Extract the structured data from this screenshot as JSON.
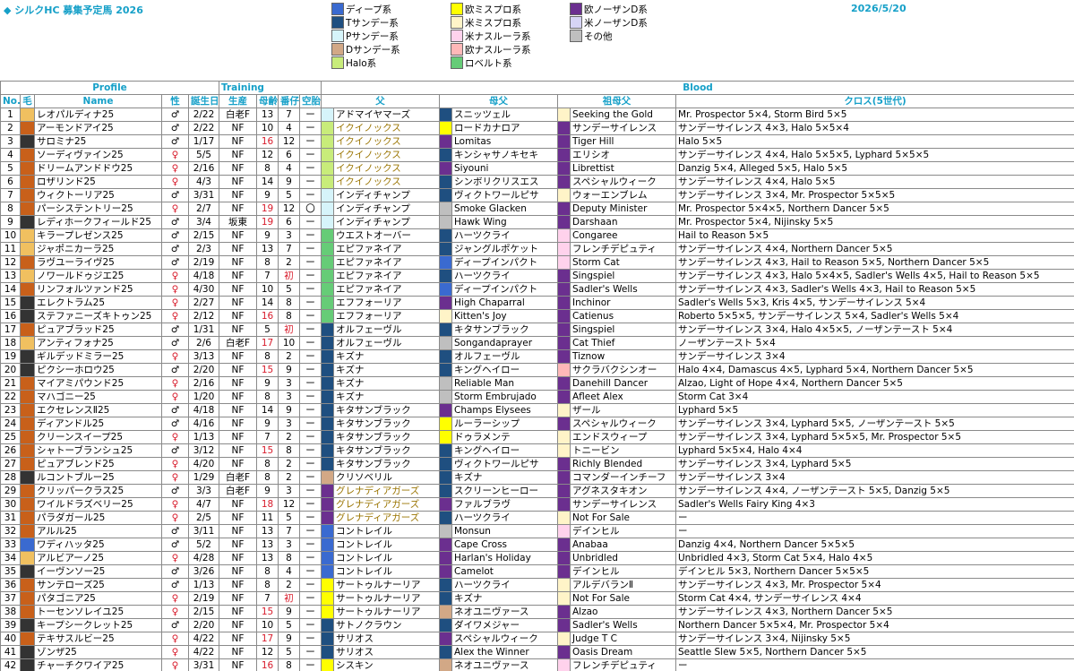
{
  "header": {
    "title": "◆ シルクHC 募集予定馬 2026",
    "date": "2026/5/20"
  },
  "legend": [
    {
      "label": "ディープ系",
      "color": "#3a6ad0"
    },
    {
      "label": "Tサンデー系",
      "color": "#1f4f80"
    },
    {
      "label": "Pサンデー系",
      "color": "#d6f4fa"
    },
    {
      "label": "Dサンデー系",
      "color": "#d2a886"
    },
    {
      "label": "Halo系",
      "color": "#c8ec7a"
    },
    {
      "label": "欧ミスプロ系",
      "color": "#ffff00"
    },
    {
      "label": "米ミスプロ系",
      "color": "#fff4c8"
    },
    {
      "label": "米ナスルーラ系",
      "color": "#ffd2ec"
    },
    {
      "label": "欧ナスルーラ系",
      "color": "#ffb8b8"
    },
    {
      "label": "ロベルト系",
      "color": "#66cc77"
    },
    {
      "label": "欧ノーザンD系",
      "color": "#6b2f8f"
    },
    {
      "label": "米ノーザンD系",
      "color": "#d6d4f5"
    },
    {
      "label": "その他",
      "color": "#bfbfbf"
    }
  ],
  "columns": {
    "group_profile": "Profile",
    "group_training": "Training",
    "group_blood": "Blood",
    "no": "No.",
    "coat": "毛",
    "name": "Name",
    "sex": "性",
    "birthday": "誕生日",
    "farm": "生産",
    "dam_age": "母齢",
    "birth_order": "番仔",
    "empty": "空胎",
    "sire": "父",
    "dam_sire": "母父",
    "dam_dam_sire": "祖母父",
    "cross": "クロス(5世代)"
  },
  "rows": [
    {
      "no": "1",
      "coat": "#f0c060",
      "name": "レオパルディナ25",
      "sex": "♂",
      "bd": "2/22",
      "farm": "白老F",
      "age": "13",
      "ord": "7",
      "emp": "ー",
      "ac": false,
      "sc": "#d6f4fa",
      "sire": "アドマイヤマーズ",
      "sg": false,
      "dc": "#1f4f80",
      "ds": "スニッツェル",
      "ddc": "#fff4c8",
      "dds": "Seeking the Gold",
      "cross": "Mr. Prospector 5×4, Storm Bird 5×5"
    },
    {
      "no": "2",
      "coat": "#c8601a",
      "name": "アーモンドアイ25",
      "sex": "♂",
      "bd": "2/22",
      "farm": "NF",
      "age": "10",
      "ord": "4",
      "emp": "ー",
      "ac": false,
      "sc": "#c8ec7a",
      "sire": "イクイノックス",
      "sg": true,
      "dc": "#ffff00",
      "ds": "ロードカナロア",
      "ddc": "#6b2f8f",
      "dds": "サンデーサイレンス",
      "cross": "サンデーサイレンス 4×3, Halo 5×5×4"
    },
    {
      "no": "3",
      "coat": "#333333",
      "name": "サロミナ25",
      "sex": "♂",
      "bd": "1/17",
      "farm": "NF",
      "age": "16",
      "ord": "12",
      "emp": "ー",
      "ac": true,
      "sc": "#c8ec7a",
      "sire": "イクイノックス",
      "sg": true,
      "dc": "#6b2f8f",
      "ds": "Lomitas",
      "ddc": "#6b2f8f",
      "dds": "Tiger Hill",
      "cross": "Halo 5×5"
    },
    {
      "no": "4",
      "coat": "#c8601a",
      "name": "ソーディヴァイン25",
      "sex": "♀",
      "bd": "5/5",
      "farm": "NF",
      "age": "12",
      "ord": "6",
      "emp": "ー",
      "ac": false,
      "sc": "#c8ec7a",
      "sire": "イクイノックス",
      "sg": true,
      "dc": "#1f4f80",
      "ds": "キンシャサノキセキ",
      "ddc": "#6b2f8f",
      "dds": "エリシオ",
      "cross": "サンデーサイレンス 4×4, Halo 5×5×5, Lyphard 5×5×5"
    },
    {
      "no": "5",
      "coat": "#c8601a",
      "name": "ドリームアンドドウ25",
      "sex": "♀",
      "bd": "2/16",
      "farm": "NF",
      "age": "8",
      "ord": "4",
      "emp": "ー",
      "ac": false,
      "sc": "#c8ec7a",
      "sire": "イクイノックス",
      "sg": true,
      "dc": "#6b2f8f",
      "ds": "Siyouni",
      "ddc": "#6b2f8f",
      "dds": "Librettist",
      "cross": "Danzig 5×4, Alleged 5×5, Halo 5×5"
    },
    {
      "no": "6",
      "coat": "#c8601a",
      "name": "ロザリンド25",
      "sex": "♀",
      "bd": "4/3",
      "farm": "NF",
      "age": "14",
      "ord": "9",
      "emp": "ー",
      "ac": false,
      "sc": "#c8ec7a",
      "sire": "イクイノックス",
      "sg": true,
      "dc": "#1f4f80",
      "ds": "シンボリクリスエス",
      "ddc": "#6b2f8f",
      "dds": "スペシャルウィーク",
      "cross": "サンデーサイレンス 4×4, Halo 5×5"
    },
    {
      "no": "7",
      "coat": "#c8601a",
      "name": "ウィクトーリア25",
      "sex": "♂",
      "bd": "3/31",
      "farm": "NF",
      "age": "9",
      "ord": "5",
      "emp": "ー",
      "ac": false,
      "sc": "#d6f4fa",
      "sire": "インディチャンプ",
      "sg": false,
      "dc": "#1f4f80",
      "ds": "ヴィクトワールピサ",
      "ddc": "#fff4c8",
      "dds": "ウォーエンブレム",
      "cross": "サンデーサイレンス 3×4, Mr. Prospector 5×5×5"
    },
    {
      "no": "8",
      "coat": "#c8601a",
      "name": "パーシステントリー25",
      "sex": "♀",
      "bd": "2/7",
      "farm": "NF",
      "age": "19",
      "ord": "12",
      "emp": "〇",
      "ac": true,
      "sc": "#d6f4fa",
      "sire": "インディチャンプ",
      "sg": false,
      "dc": "#bfbfbf",
      "ds": "Smoke Glacken",
      "ddc": "#6b2f8f",
      "dds": "Deputy Minister",
      "cross": "Mr. Prospector 5×4×5, Northern Dancer 5×5"
    },
    {
      "no": "9",
      "coat": "#333333",
      "name": "レディホークフィールド25",
      "sex": "♂",
      "bd": "3/4",
      "farm": "坂東",
      "age": "19",
      "ord": "6",
      "emp": "ー",
      "ac": true,
      "sc": "#d6f4fa",
      "sire": "インディチャンプ",
      "sg": false,
      "dc": "#bfbfbf",
      "ds": "Hawk Wing",
      "ddc": "#6b2f8f",
      "dds": "Darshaan",
      "cross": "Mr. Prospector 5×4, Nijinsky 5×5"
    },
    {
      "no": "10",
      "coat": "#f0c060",
      "name": "キラープレゼンス25",
      "sex": "♂",
      "bd": "2/15",
      "farm": "NF",
      "age": "9",
      "ord": "3",
      "emp": "ー",
      "ac": false,
      "sc": "#66cc77",
      "sire": "ウエストオーバー",
      "sg": false,
      "dc": "#1f4f80",
      "ds": "ハーツクライ",
      "ddc": "#ffd2ec",
      "dds": "Congaree",
      "cross": "Hail to Reason 5×5"
    },
    {
      "no": "11",
      "coat": "#f0c060",
      "name": "ジャポニカーラ25",
      "sex": "♂",
      "bd": "2/3",
      "farm": "NF",
      "age": "13",
      "ord": "7",
      "emp": "ー",
      "ac": false,
      "sc": "#66cc77",
      "sire": "エピファネイア",
      "sg": false,
      "dc": "#1f4f80",
      "ds": "ジャングルポケット",
      "ddc": "#ffd2ec",
      "dds": "フレンチデピュティ",
      "cross": "サンデーサイレンス 4×4, Northern Dancer 5×5"
    },
    {
      "no": "12",
      "coat": "#c8601a",
      "name": "ラヴユーライヴ25",
      "sex": "♂",
      "bd": "2/19",
      "farm": "NF",
      "age": "8",
      "ord": "2",
      "emp": "ー",
      "ac": false,
      "sc": "#66cc77",
      "sire": "エピファネイア",
      "sg": false,
      "dc": "#3a6ad0",
      "ds": "ディープインパクト",
      "ddc": "#ffd2ec",
      "dds": "Storm Cat",
      "cross": "サンデーサイレンス 4×3, Hail to Reason 5×5, Northern Dancer 5×5"
    },
    {
      "no": "13",
      "coat": "#f0c060",
      "name": "ノワールドゥジエ25",
      "sex": "♀",
      "bd": "4/18",
      "farm": "NF",
      "age": "7",
      "ord": "初",
      "emp": "ー",
      "ac": false,
      "sc": "#66cc77",
      "sire": "エピファネイア",
      "sg": false,
      "dc": "#1f4f80",
      "ds": "ハーツクライ",
      "ddc": "#6b2f8f",
      "dds": "Singspiel",
      "cross": "サンデーサイレンス 4×3, Halo 5×4×5, Sadler's Wells 4×5, Hail to Reason 5×5"
    },
    {
      "no": "14",
      "coat": "#c8601a",
      "name": "リンフォルツァンド25",
      "sex": "♀",
      "bd": "4/30",
      "farm": "NF",
      "age": "10",
      "ord": "5",
      "emp": "ー",
      "ac": false,
      "sc": "#66cc77",
      "sire": "エピファネイア",
      "sg": false,
      "dc": "#3a6ad0",
      "ds": "ディープインパクト",
      "ddc": "#6b2f8f",
      "dds": "Sadler's Wells",
      "cross": "サンデーサイレンス 4×3, Sadler's Wells 4×3, Hail to Reason 5×5"
    },
    {
      "no": "15",
      "coat": "#333333",
      "name": "エレクトラム25",
      "sex": "♀",
      "bd": "2/27",
      "farm": "NF",
      "age": "14",
      "ord": "8",
      "emp": "ー",
      "ac": false,
      "sc": "#66cc77",
      "sire": "エフフォーリア",
      "sg": false,
      "dc": "#6b2f8f",
      "ds": "High Chaparral",
      "ddc": "#6b2f8f",
      "dds": "Inchinor",
      "cross": "Sadler's Wells 5×3, Kris 4×5, サンデーサイレンス 5×4"
    },
    {
      "no": "16",
      "coat": "#333333",
      "name": "ステファニーズキトゥン25",
      "sex": "♀",
      "bd": "2/12",
      "farm": "NF",
      "age": "16",
      "ord": "8",
      "emp": "ー",
      "ac": true,
      "sc": "#66cc77",
      "sire": "エフフォーリア",
      "sg": false,
      "dc": "#fff4c8",
      "ds": "Kitten's Joy",
      "ddc": "#6b2f8f",
      "dds": "Catienus",
      "cross": "Roberto 5×5×5, サンデーサイレンス 5×4, Sadler's Wells 5×4"
    },
    {
      "no": "17",
      "coat": "#c8601a",
      "name": "ピュアブラッド25",
      "sex": "♂",
      "bd": "1/31",
      "farm": "NF",
      "age": "5",
      "ord": "初",
      "emp": "ー",
      "ac": false,
      "sc": "#1f4f80",
      "sire": "オルフェーヴル",
      "sg": false,
      "dc": "#1f4f80",
      "ds": "キタサンブラック",
      "ddc": "#6b2f8f",
      "dds": "Singspiel",
      "cross": "サンデーサイレンス 3×4, Halo 4×5×5, ノーザンテースト 5×4"
    },
    {
      "no": "18",
      "coat": "#f0c060",
      "name": "アンティフォナ25",
      "sex": "♂",
      "bd": "2/6",
      "farm": "白老F",
      "age": "17",
      "ord": "10",
      "emp": "ー",
      "ac": true,
      "sc": "#1f4f80",
      "sire": "オルフェーヴル",
      "sg": false,
      "dc": "#bfbfbf",
      "ds": "Songandaprayer",
      "ddc": "#6b2f8f",
      "dds": "Cat Thief",
      "cross": "ノーザンテースト 5×4"
    },
    {
      "no": "19",
      "coat": "#333333",
      "name": "ギルデッドミラー25",
      "sex": "♀",
      "bd": "3/13",
      "farm": "NF",
      "age": "8",
      "ord": "2",
      "emp": "ー",
      "ac": false,
      "sc": "#1f4f80",
      "sire": "キズナ",
      "sg": false,
      "dc": "#1f4f80",
      "ds": "オルフェーヴル",
      "ddc": "#6b2f8f",
      "dds": "Tiznow",
      "cross": "サンデーサイレンス 3×4"
    },
    {
      "no": "20",
      "coat": "#333333",
      "name": "ピクシーホロウ25",
      "sex": "♂",
      "bd": "2/20",
      "farm": "NF",
      "age": "15",
      "ord": "9",
      "emp": "ー",
      "ac": true,
      "sc": "#1f4f80",
      "sire": "キズナ",
      "sg": false,
      "dc": "#1f4f80",
      "ds": "キングヘイロー",
      "ddc": "#ffb8b8",
      "dds": "サクラバクシンオー",
      "cross": "Halo 4×4, Damascus 4×5, Lyphard 5×4, Northern Dancer 5×5"
    },
    {
      "no": "21",
      "coat": "#c8601a",
      "name": "マイアミパウンド25",
      "sex": "♀",
      "bd": "2/16",
      "farm": "NF",
      "age": "9",
      "ord": "3",
      "emp": "ー",
      "ac": false,
      "sc": "#1f4f80",
      "sire": "キズナ",
      "sg": false,
      "dc": "#bfbfbf",
      "ds": "Reliable Man",
      "ddc": "#6b2f8f",
      "dds": "Danehill Dancer",
      "cross": "Alzao, Light of Hope 4×4, Northern Dancer 5×5"
    },
    {
      "no": "22",
      "coat": "#c8601a",
      "name": "マハゴニー25",
      "sex": "♀",
      "bd": "1/20",
      "farm": "NF",
      "age": "8",
      "ord": "3",
      "emp": "ー",
      "ac": false,
      "sc": "#1f4f80",
      "sire": "キズナ",
      "sg": false,
      "dc": "#bfbfbf",
      "ds": "Storm Embrujado",
      "ddc": "#6b2f8f",
      "dds": "Afleet Alex",
      "cross": "Storm Cat 3×4"
    },
    {
      "no": "23",
      "coat": "#c8601a",
      "name": "エクセレンスⅡ25",
      "sex": "♂",
      "bd": "4/18",
      "farm": "NF",
      "age": "14",
      "ord": "9",
      "emp": "ー",
      "ac": false,
      "sc": "#1f4f80",
      "sire": "キタサンブラック",
      "sg": false,
      "dc": "#6b2f8f",
      "ds": "Champs Elysees",
      "ddc": "#fff4c8",
      "dds": "ザール",
      "cross": "Lyphard 5×5"
    },
    {
      "no": "24",
      "coat": "#c8601a",
      "name": "ディアンドル25",
      "sex": "♂",
      "bd": "4/16",
      "farm": "NF",
      "age": "9",
      "ord": "3",
      "emp": "ー",
      "ac": false,
      "sc": "#1f4f80",
      "sire": "キタサンブラック",
      "sg": false,
      "dc": "#ffff00",
      "ds": "ルーラーシップ",
      "ddc": "#6b2f8f",
      "dds": "スペシャルウィーク",
      "cross": "サンデーサイレンス 3×4, Lyphard 5×5, ノーザンテースト 5×5"
    },
    {
      "no": "25",
      "coat": "#c8601a",
      "name": "クリーンスイープ25",
      "sex": "♀",
      "bd": "1/13",
      "farm": "NF",
      "age": "7",
      "ord": "2",
      "emp": "ー",
      "ac": false,
      "sc": "#1f4f80",
      "sire": "キタサンブラック",
      "sg": false,
      "dc": "#ffff00",
      "ds": "ドゥラメンテ",
      "ddc": "#fff4c8",
      "dds": "エンドスウィープ",
      "cross": "サンデーサイレンス 3×4, Lyphard 5×5×5, Mr. Prospector 5×5"
    },
    {
      "no": "26",
      "coat": "#c8601a",
      "name": "シャトーブランシュ25",
      "sex": "♂",
      "bd": "3/12",
      "farm": "NF",
      "age": "15",
      "ord": "8",
      "emp": "ー",
      "ac": true,
      "sc": "#1f4f80",
      "sire": "キタサンブラック",
      "sg": false,
      "dc": "#1f4f80",
      "ds": "キングヘイロー",
      "ddc": "#fff4c8",
      "dds": "トニービン",
      "cross": "Lyphard 5×5×4, Halo 4×4"
    },
    {
      "no": "27",
      "coat": "#c8601a",
      "name": "ピュアブレンド25",
      "sex": "♀",
      "bd": "4/20",
      "farm": "NF",
      "age": "8",
      "ord": "2",
      "emp": "ー",
      "ac": false,
      "sc": "#1f4f80",
      "sire": "キタサンブラック",
      "sg": false,
      "dc": "#1f4f80",
      "ds": "ヴィクトワールピサ",
      "ddc": "#6b2f8f",
      "dds": "Richly Blended",
      "cross": "サンデーサイレンス 3×4, Lyphard 5×5"
    },
    {
      "no": "28",
      "coat": "#333333",
      "name": "ルコントブルー25",
      "sex": "♀",
      "bd": "1/29",
      "farm": "白老F",
      "age": "8",
      "ord": "2",
      "emp": "ー",
      "ac": false,
      "sc": "#d2a886",
      "sire": "クリソベリル",
      "sg": false,
      "dc": "#1f4f80",
      "ds": "キズナ",
      "ddc": "#6b2f8f",
      "dds": "コマンダーインチーフ",
      "cross": "サンデーサイレンス 3×4"
    },
    {
      "no": "29",
      "coat": "#c8601a",
      "name": "クリッパークラス25",
      "sex": "♂",
      "bd": "3/3",
      "farm": "白老F",
      "age": "9",
      "ord": "3",
      "emp": "ー",
      "ac": false,
      "sc": "#6b2f8f",
      "sire": "グレナディアガーズ",
      "sg": true,
      "dc": "#1f4f80",
      "ds": "スクリーンヒーロー",
      "ddc": "#6b2f8f",
      "dds": "アグネスタキオン",
      "cross": "サンデーサイレンス 4×4, ノーザンテースト 5×5, Danzig 5×5"
    },
    {
      "no": "30",
      "coat": "#c8601a",
      "name": "ワイルドラズベリー25",
      "sex": "♀",
      "bd": "4/7",
      "farm": "NF",
      "age": "18",
      "ord": "12",
      "emp": "ー",
      "ac": true,
      "sc": "#6b2f8f",
      "sire": "グレナディアガーズ",
      "sg": true,
      "dc": "#6b2f8f",
      "ds": "ファルブラヴ",
      "ddc": "#6b2f8f",
      "dds": "サンデーサイレンス",
      "cross": "Sadler's Wells Fairy King 4×3"
    },
    {
      "no": "31",
      "coat": "#c8601a",
      "name": "パラダガール25",
      "sex": "♀",
      "bd": "2/5",
      "farm": "NF",
      "age": "11",
      "ord": "5",
      "emp": "ー",
      "ac": false,
      "sc": "#6b2f8f",
      "sire": "グレナディアガーズ",
      "sg": true,
      "dc": "#1f4f80",
      "ds": "ハーツクライ",
      "ddc": "#fff4c8",
      "dds": "Not For Sale",
      "cross": "ー"
    },
    {
      "no": "32",
      "coat": "#c8601a",
      "name": "アルル25",
      "sex": "♂",
      "bd": "3/11",
      "farm": "NF",
      "age": "13",
      "ord": "7",
      "emp": "ー",
      "ac": false,
      "sc": "#3a6ad0",
      "sire": "コントレイル",
      "sg": false,
      "dc": "#bfbfbf",
      "ds": "Monsun",
      "ddc": "#ffd2ec",
      "dds": "デインヒル",
      "cross": "ー"
    },
    {
      "no": "33",
      "coat": "#3a6ad0",
      "name": "ワディハッタ25",
      "sex": "♂",
      "bd": "5/2",
      "farm": "NF",
      "age": "13",
      "ord": "3",
      "emp": "ー",
      "ac": false,
      "sc": "#3a6ad0",
      "sire": "コントレイル",
      "sg": false,
      "dc": "#6b2f8f",
      "ds": "Cape Cross",
      "ddc": "#6b2f8f",
      "dds": "Anabaa",
      "cross": "Danzig 4×4, Northern Dancer 5×5×5"
    },
    {
      "no": "34",
      "coat": "#f0c060",
      "name": "アルビアーノ25",
      "sex": "♀",
      "bd": "4/28",
      "farm": "NF",
      "age": "13",
      "ord": "8",
      "emp": "ー",
      "ac": false,
      "sc": "#3a6ad0",
      "sire": "コントレイル",
      "sg": false,
      "dc": "#6b2f8f",
      "ds": "Harlan's Holiday",
      "ddc": "#6b2f8f",
      "dds": "Unbridled",
      "cross": "Unbridled 4×3, Storm Cat 5×4, Halo 4×5"
    },
    {
      "no": "35",
      "coat": "#333333",
      "name": "イーヴンソー25",
      "sex": "♂",
      "bd": "3/26",
      "farm": "NF",
      "age": "8",
      "ord": "4",
      "emp": "ー",
      "ac": false,
      "sc": "#3a6ad0",
      "sire": "コントレイル",
      "sg": false,
      "dc": "#6b2f8f",
      "ds": "Camelot",
      "ddc": "#6b2f8f",
      "dds": "デインヒル",
      "cross": "デインヒル 5×3, Northern Dancer 5×5×5"
    },
    {
      "no": "36",
      "coat": "#c8601a",
      "name": "サンテローズ25",
      "sex": "♂",
      "bd": "1/13",
      "farm": "NF",
      "age": "8",
      "ord": "2",
      "emp": "ー",
      "ac": false,
      "sc": "#ffff00",
      "sire": "サートゥルナーリア",
      "sg": false,
      "dc": "#1f4f80",
      "ds": "ハーツクライ",
      "ddc": "#fff4c8",
      "dds": "アルデバランⅡ",
      "cross": "サンデーサイレンス 4×3, Mr. Prospector 5×4"
    },
    {
      "no": "37",
      "coat": "#c8601a",
      "name": "パタゴニア25",
      "sex": "♀",
      "bd": "2/19",
      "farm": "NF",
      "age": "7",
      "ord": "初",
      "emp": "ー",
      "ac": false,
      "sc": "#ffff00",
      "sire": "サートゥルナーリア",
      "sg": false,
      "dc": "#1f4f80",
      "ds": "キズナ",
      "ddc": "#fff4c8",
      "dds": "Not For Sale",
      "cross": "Storm Cat 4×4, サンデーサイレンス 4×4"
    },
    {
      "no": "38",
      "coat": "#c8601a",
      "name": "トーセンソレイユ25",
      "sex": "♀",
      "bd": "2/15",
      "farm": "NF",
      "age": "15",
      "ord": "9",
      "emp": "ー",
      "ac": true,
      "sc": "#ffff00",
      "sire": "サートゥルナーリア",
      "sg": false,
      "dc": "#d2a886",
      "ds": "ネオユニヴァース",
      "ddc": "#6b2f8f",
      "dds": "Alzao",
      "cross": "サンデーサイレンス 4×3, Northern Dancer 5×5"
    },
    {
      "no": "39",
      "coat": "#333333",
      "name": "キープシークレット25",
      "sex": "♂",
      "bd": "2/20",
      "farm": "NF",
      "age": "10",
      "ord": "5",
      "emp": "ー",
      "ac": false,
      "sc": "#1f4f80",
      "sire": "サトノクラウン",
      "sg": false,
      "dc": "#1f4f80",
      "ds": "ダイワメジャー",
      "ddc": "#6b2f8f",
      "dds": "Sadler's Wells",
      "cross": "Northern Dancer 5×5×4, Mr. Prospector 5×4"
    },
    {
      "no": "40",
      "coat": "#c8601a",
      "name": "テキサスルビー25",
      "sex": "♀",
      "bd": "4/22",
      "farm": "NF",
      "age": "17",
      "ord": "9",
      "emp": "ー",
      "ac": true,
      "sc": "#1f4f80",
      "sire": "サリオス",
      "sg": false,
      "dc": "#6b2f8f",
      "ds": "スペシャルウィーク",
      "ddc": "#fff4c8",
      "dds": "Judge T C",
      "cross": "サンデーサイレンス 3×4, Nijinsky 5×5"
    },
    {
      "no": "41",
      "coat": "#333333",
      "name": "ゾンザ25",
      "sex": "♀",
      "bd": "4/22",
      "farm": "NF",
      "age": "12",
      "ord": "5",
      "emp": "ー",
      "ac": false,
      "sc": "#1f4f80",
      "sire": "サリオス",
      "sg": false,
      "dc": "#1f4f80",
      "ds": "Alex the Winner",
      "ddc": "#6b2f8f",
      "dds": "Oasis Dream",
      "cross": "Seattle Slew 5×5, Northern Dancer 5×5"
    },
    {
      "no": "42",
      "coat": "#333333",
      "name": "チャーチクワイア25",
      "sex": "♀",
      "bd": "3/31",
      "farm": "NF",
      "age": "16",
      "ord": "8",
      "emp": "ー",
      "ac": true,
      "sc": "#ffff00",
      "sire": "シスキン",
      "sg": false,
      "dc": "#d2a886",
      "ds": "ネオユニヴァース",
      "ddc": "#ffd2ec",
      "dds": "フレンチデピュティ",
      "cross": "ー"
    }
  ]
}
